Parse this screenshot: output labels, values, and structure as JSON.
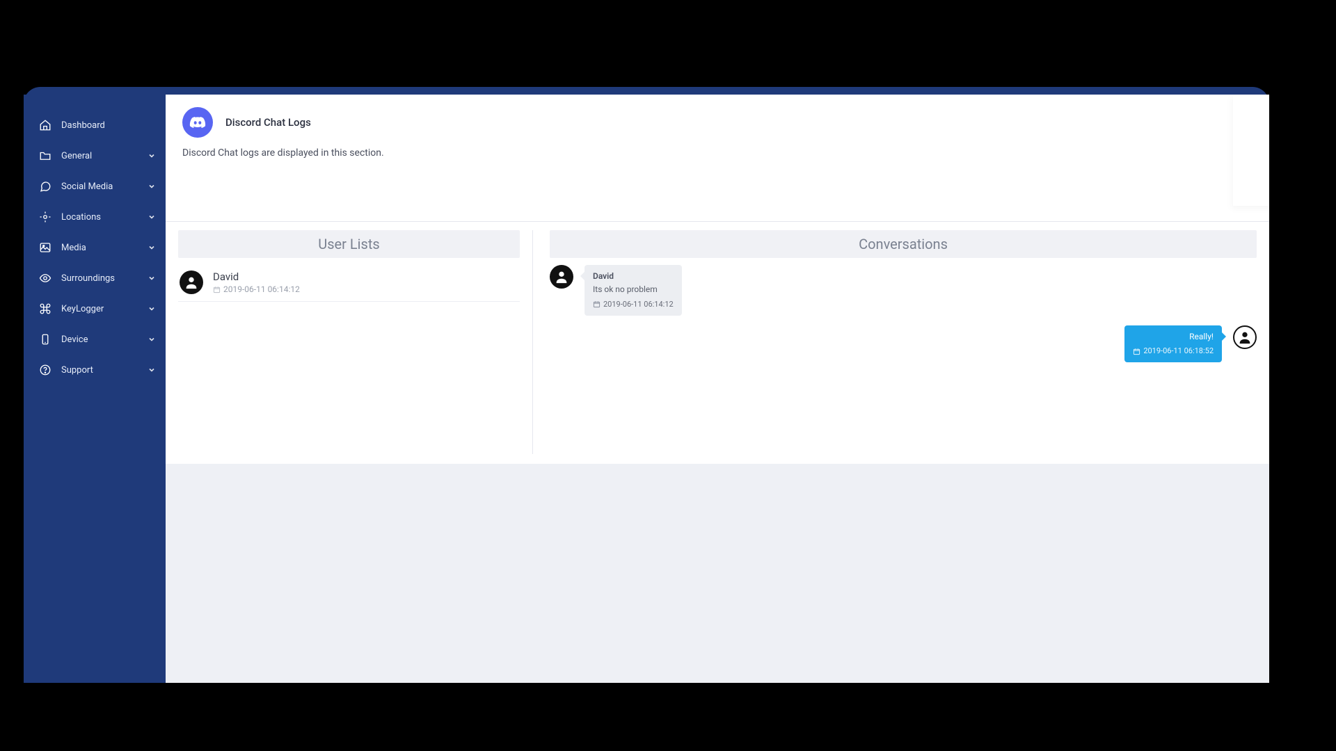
{
  "sidebar": {
    "items": [
      {
        "label": "Dashboard",
        "icon": "home",
        "expandable": false
      },
      {
        "label": "General",
        "icon": "folder",
        "expandable": true
      },
      {
        "label": "Social Media",
        "icon": "chat",
        "expandable": true
      },
      {
        "label": "Locations",
        "icon": "location",
        "expandable": true
      },
      {
        "label": "Media",
        "icon": "image",
        "expandable": true
      },
      {
        "label": "Surroundings",
        "icon": "eye",
        "expandable": true
      },
      {
        "label": "KeyLogger",
        "icon": "command",
        "expandable": true
      },
      {
        "label": "Device",
        "icon": "phone",
        "expandable": true
      },
      {
        "label": "Support",
        "icon": "help",
        "expandable": true
      }
    ]
  },
  "header": {
    "title": "Discord Chat Logs",
    "subtitle": "Discord Chat logs are displayed in this section."
  },
  "panels": {
    "user_lists_title": "User Lists",
    "conversations_title": "Conversations"
  },
  "users": [
    {
      "name": "David",
      "timestamp": "2019-06-11 06:14:12"
    }
  ],
  "messages": [
    {
      "direction": "in",
      "sender": "David",
      "body": "Its ok no problem",
      "timestamp": "2019-06-11 06:14:12"
    },
    {
      "direction": "out",
      "sender": "",
      "body": "Really!",
      "timestamp": "2019-06-11 06:18:52"
    }
  ],
  "colors": {
    "sidebar_bg": "#1f3a7a",
    "accent": "#1fa4e8",
    "discord": "#5865F2"
  }
}
